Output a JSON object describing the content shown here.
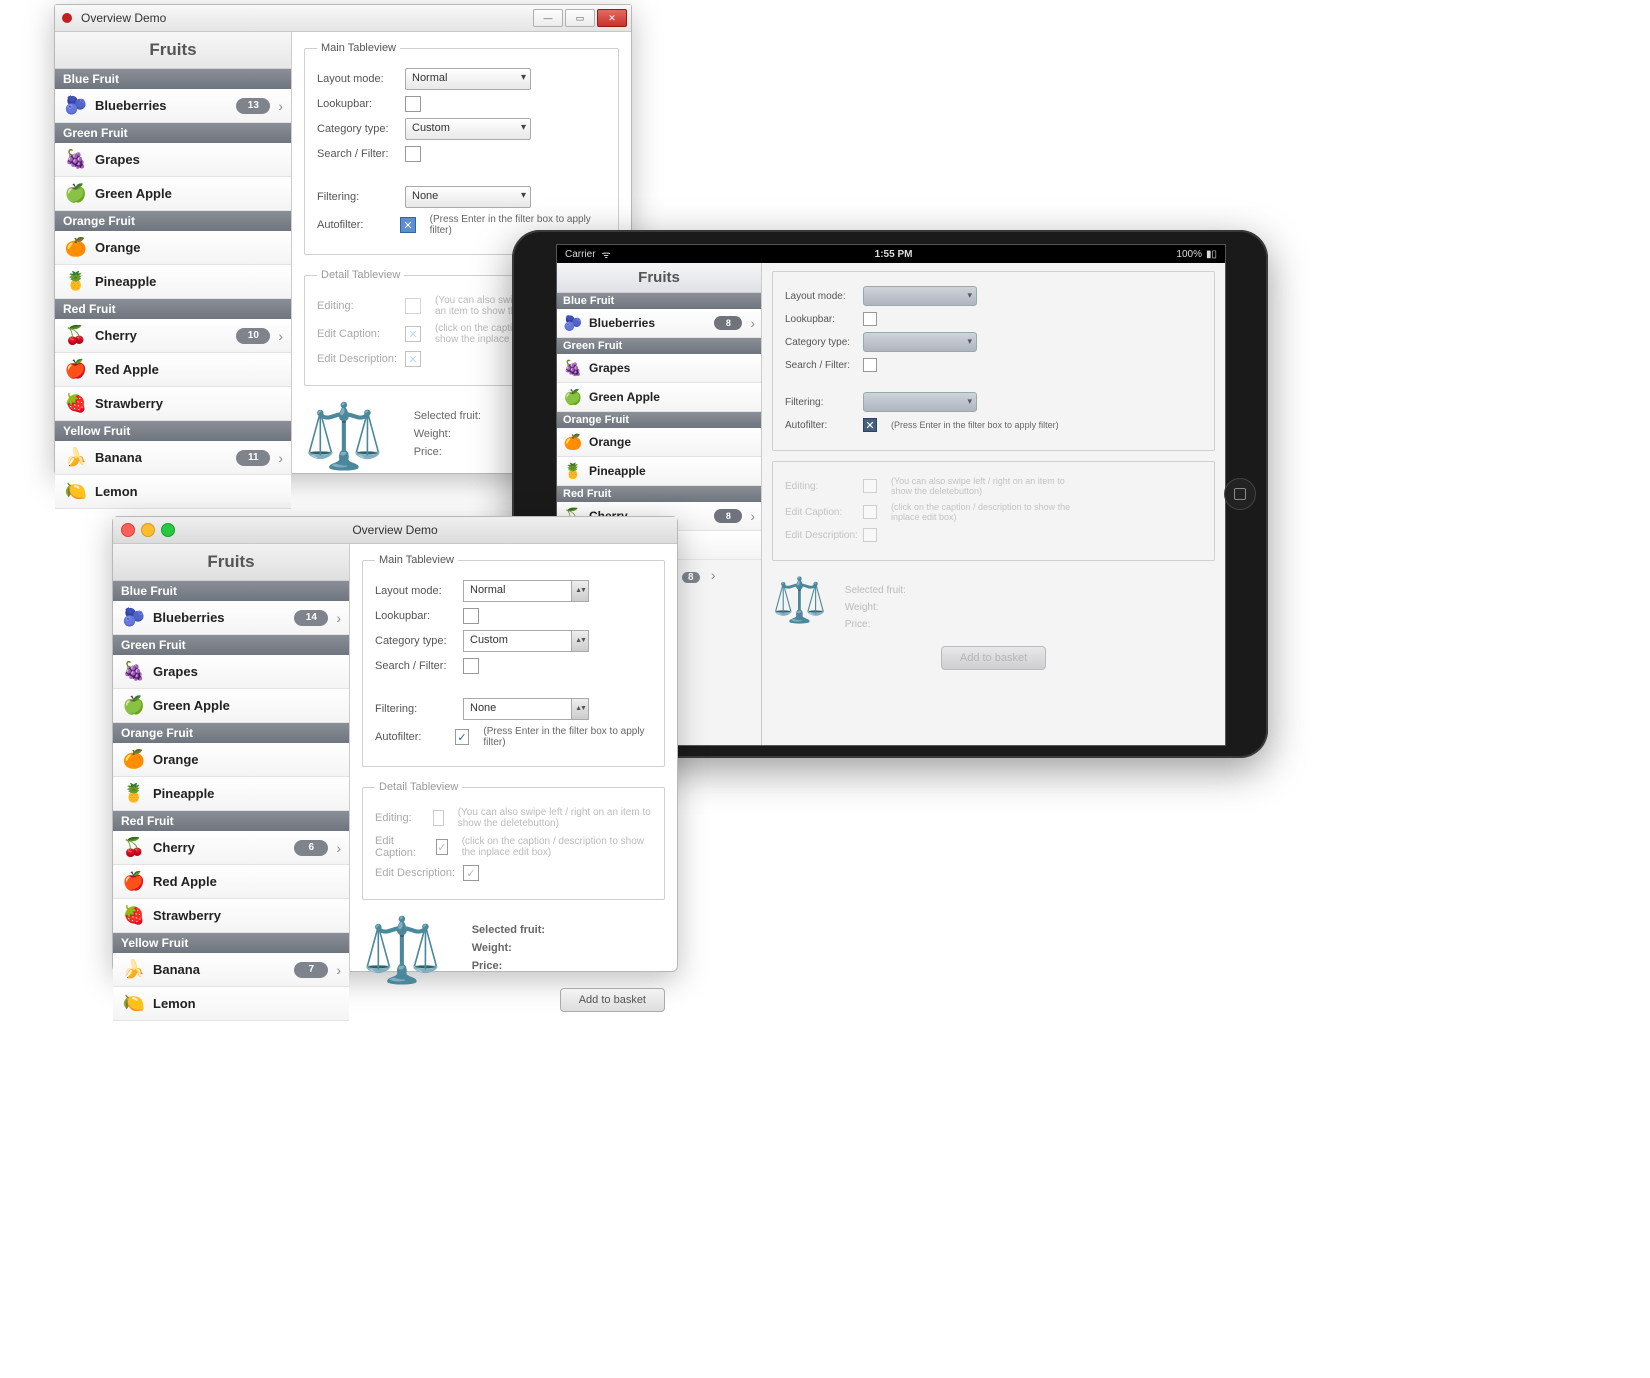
{
  "common": {
    "fruits_title": "Fruits",
    "main_legend": "Main Tableview",
    "detail_legend": "Detail Tableview",
    "lbl_layout": "Layout mode:",
    "lbl_lookup": "Lookupbar:",
    "lbl_cattype": "Category type:",
    "lbl_search": "Search / Filter:",
    "lbl_filtering": "Filtering:",
    "lbl_autofilter": "Autofilter:",
    "autofilter_hint": "(Press Enter in the filter box to apply filter)",
    "lbl_editing": "Editing:",
    "editing_hint": "(You can also swipe left / right on an item to show the deletebutton)",
    "lbl_editcap": "Edit Caption:",
    "lbl_editdesc": "Edit Description:",
    "editcap_hint": "(click on the caption / description to show the inplace edit box)",
    "lbl_selfruit": "Selected fruit:",
    "lbl_weight": "Weight:",
    "lbl_price": "Price:",
    "btn_add": "Add to basket",
    "val_layout": "Normal",
    "val_cattype": "Custom",
    "val_filtering": "None"
  },
  "categories": {
    "blue": "Blue Fruit",
    "green": "Green Fruit",
    "orange": "Orange Fruit",
    "red": "Red Fruit",
    "yellow": "Yellow Fruit"
  },
  "fruits": {
    "blueberries": "Blueberries",
    "grapes": "Grapes",
    "greenapple": "Green Apple",
    "orange": "Orange",
    "pineapple": "Pineapple",
    "cherry": "Cherry",
    "redapple": "Red Apple",
    "strawberry": "Strawberry",
    "banana": "Banana",
    "lemon": "Lemon"
  },
  "win": {
    "title": "Overview Demo",
    "badges": {
      "blueberries": "13",
      "cherry": "10",
      "banana": "11"
    },
    "autofilter_checked": "✕"
  },
  "mac": {
    "title": "Overview Demo",
    "badges": {
      "blueberries": "14",
      "cherry": "6",
      "banana": "7"
    },
    "autofilter_checked": "✓",
    "editcap_checked": "✓",
    "editdesc_checked": "✓"
  },
  "ipad": {
    "status_carrier": "Carrier",
    "status_time": "1:55 PM",
    "status_batt": "100%",
    "badges": {
      "blueberries": "8",
      "cherry": "8",
      "redapple_overflow": "8"
    },
    "autofilter_checked": "✕"
  }
}
